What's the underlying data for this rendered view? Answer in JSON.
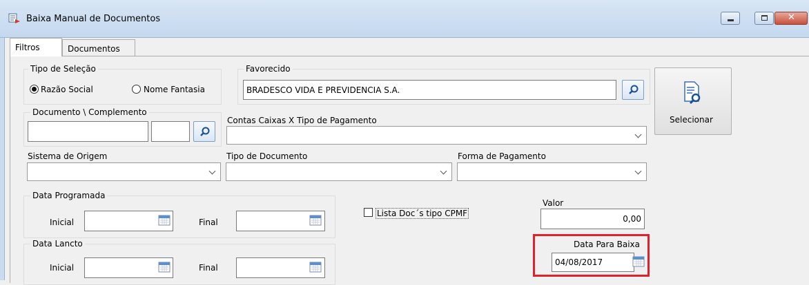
{
  "window": {
    "title": "Baixa Manual de Documentos",
    "min_icon": "minimize-icon",
    "max_icon": "maximize-icon",
    "close_icon": "close-icon"
  },
  "tabs": [
    {
      "label": "Filtros",
      "active": true
    },
    {
      "label": "Documentos",
      "active": false
    }
  ],
  "tipo_selecao": {
    "label": "Tipo de Seleção",
    "options": [
      "Razão Social",
      "Nome Fantasia"
    ],
    "selected": "Razão Social"
  },
  "favorecido": {
    "label": "Favorecido",
    "value": "BRADESCO VIDA E PREVIDENCIA S.A."
  },
  "selecionar": {
    "label": "Selecionar"
  },
  "documento": {
    "label": "Documento \\ Complemento",
    "value": "",
    "complemento": ""
  },
  "contas_caixas": {
    "label": "Contas Caixas X Tipo de Pagamento",
    "value": ""
  },
  "sistema_origem": {
    "label": "Sistema de Origem",
    "value": ""
  },
  "tipo_documento": {
    "label": "Tipo de Documento",
    "value": ""
  },
  "forma_pagamento": {
    "label": "Forma de Pagamento",
    "value": ""
  },
  "data_programada": {
    "label": "Data Programada",
    "inicial_label": "Inicial",
    "final_label": "Final",
    "inicial": "",
    "final": ""
  },
  "data_lancto": {
    "label": "Data Lancto",
    "inicial_label": "Inicial",
    "final_label": "Final",
    "inicial": "",
    "final": ""
  },
  "lista_cpmf": {
    "label": "Lista Doc´s tipo CPMF",
    "checked": false
  },
  "valor": {
    "label": "Valor",
    "value": "0,00"
  },
  "data_baixa": {
    "label": "Data Para Baixa",
    "value": "04/08/2017"
  },
  "colors": {
    "highlight": "#e2202a",
    "title_bar": "#c4d8ee"
  }
}
